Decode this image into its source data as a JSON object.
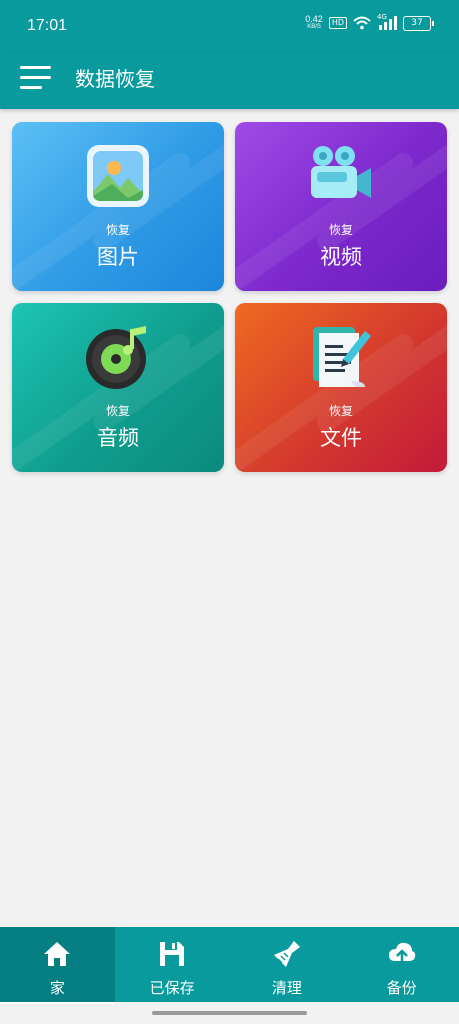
{
  "status": {
    "time": "17:01",
    "net_speed": "0.42",
    "net_unit": "KB/S",
    "hd": "HD",
    "signal_label": "4G",
    "battery": "37"
  },
  "header": {
    "title": "数据恢复"
  },
  "cards": [
    {
      "sub": "恢复",
      "label": "图片",
      "icon": "image-icon"
    },
    {
      "sub": "恢复",
      "label": "视频",
      "icon": "video-camera-icon"
    },
    {
      "sub": "恢复",
      "label": "音频",
      "icon": "music-disc-icon"
    },
    {
      "sub": "恢复",
      "label": "文件",
      "icon": "document-icon"
    }
  ],
  "nav": [
    {
      "label": "家",
      "icon": "home-icon",
      "active": true
    },
    {
      "label": "已保存",
      "icon": "save-icon"
    },
    {
      "label": "清理",
      "icon": "broom-icon"
    },
    {
      "label": "备份",
      "icon": "cloud-upload-icon"
    }
  ],
  "colors": {
    "primary": "#089a9c",
    "active_nav": "#057f82",
    "background": "#f2f2f3"
  }
}
